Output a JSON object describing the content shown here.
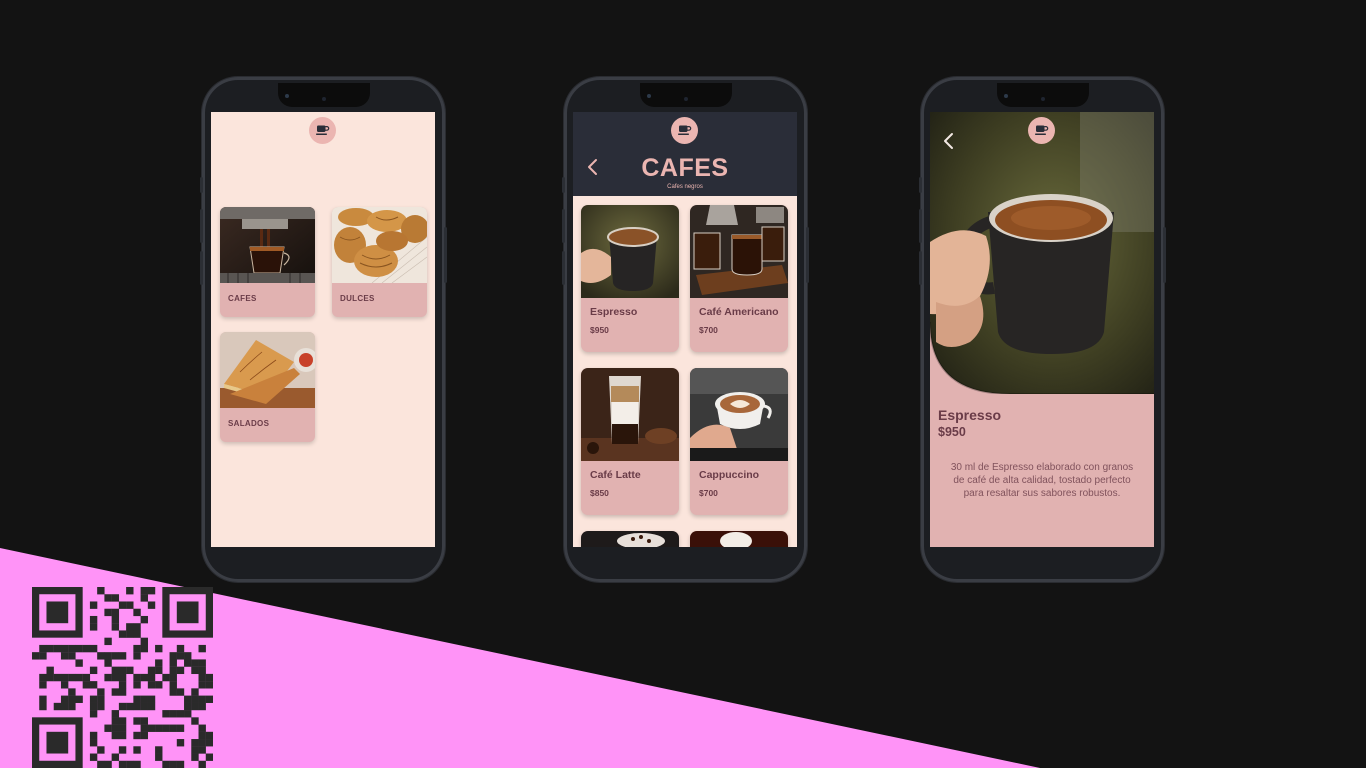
{
  "colors": {
    "background": "#131313",
    "accent_pink": "#ff93f7",
    "screen_cream": "#fbe5dc",
    "card_pink": "#e1b2b1",
    "text_plum": "#6a3c48",
    "header_dark": "#2a2d38"
  },
  "icons": {
    "logo": "coffee-cup-icon",
    "back": "chevron-left-icon",
    "qr": "qr-code"
  },
  "screen_categories": {
    "categories": [
      {
        "label": "CAFES",
        "image": "espresso-machine-photo"
      },
      {
        "label": "DULCES",
        "image": "croissants-photo"
      },
      {
        "label": "SALADOS",
        "image": "grilled-sandwich-photo"
      }
    ]
  },
  "screen_list": {
    "title": "CAFES",
    "subtitle": "Cafes negros",
    "products": [
      {
        "name": "Espresso",
        "price": "$950",
        "image": "espresso-cup-photo"
      },
      {
        "name": "Café Americano",
        "price": "$700",
        "image": "americano-photo"
      },
      {
        "name": "Café Latte",
        "price": "$850",
        "image": "latte-glass-photo"
      },
      {
        "name": "Cappuccino",
        "price": "$700",
        "image": "cappuccino-photo"
      }
    ]
  },
  "screen_detail": {
    "name": "Espresso",
    "price": "$950",
    "description": "30 ml de Espresso elaborado con granos de café de alta calidad, tostado perfecto para resaltar sus sabores robustos."
  }
}
